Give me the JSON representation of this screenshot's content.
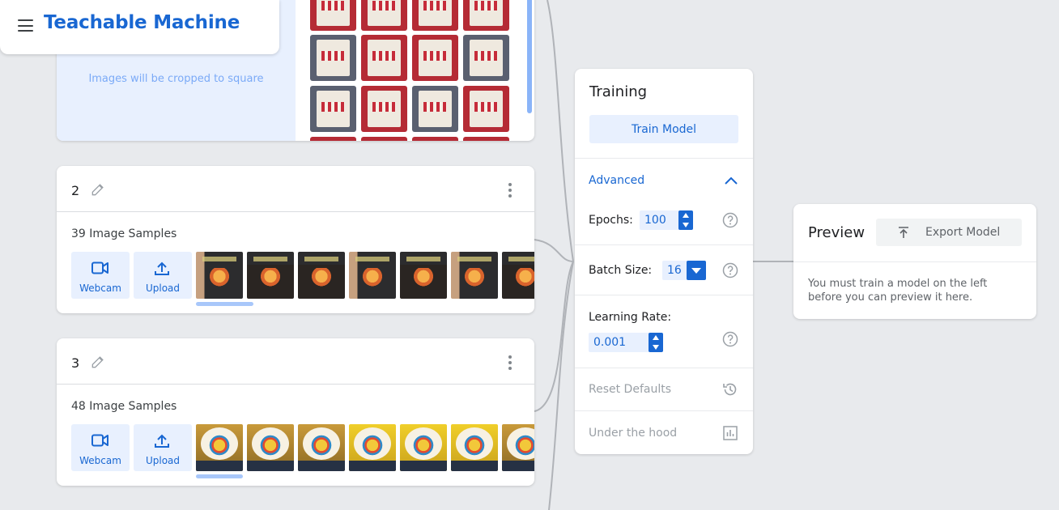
{
  "app": {
    "title": "Teachable Machine"
  },
  "class1": {
    "crop_note": "Images will be cropped to square"
  },
  "classes": [
    {
      "name": "2",
      "sample_count": "39 Image Samples",
      "webcam_label": "Webcam",
      "upload_label": "Upload"
    },
    {
      "name": "3",
      "sample_count": "48 Image Samples",
      "webcam_label": "Webcam",
      "upload_label": "Upload"
    }
  ],
  "training": {
    "title": "Training",
    "train_button": "Train Model",
    "advanced_label": "Advanced",
    "epochs_label": "Epochs:",
    "epochs_value": "100",
    "batch_label": "Batch Size:",
    "batch_value": "16",
    "lr_label": "Learning Rate:",
    "lr_value": "0.001",
    "reset_label": "Reset Defaults",
    "under_hood_label": "Under the hood"
  },
  "preview": {
    "title": "Preview",
    "export_button": "Export Model",
    "message": "You must train a model on the left before you can preview it here."
  },
  "colors": {
    "accent": "#1967d2",
    "accent_light": "#e8f0fe",
    "background": "#e8eaed"
  },
  "icons": [
    "menu-icon",
    "pencil-icon",
    "more-vert-icon",
    "webcam-icon",
    "upload-icon",
    "chevron-up-icon",
    "help-icon",
    "history-icon",
    "bar-chart-icon",
    "export-icon"
  ]
}
